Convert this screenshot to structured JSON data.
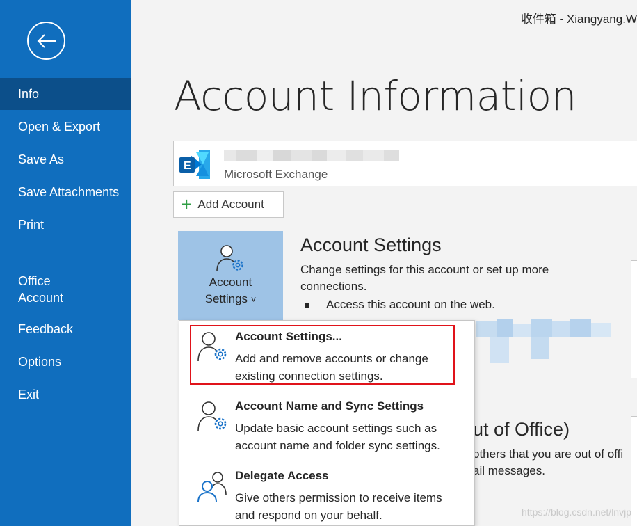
{
  "window": {
    "title": "收件箱 - Xiangyang.W"
  },
  "sidebar": {
    "items": [
      {
        "label": "Info",
        "active": true
      },
      {
        "label": "Open & Export"
      },
      {
        "label": "Save As"
      },
      {
        "label": "Save Attachments"
      },
      {
        "label": "Print"
      }
    ],
    "office_account": [
      "Office",
      "Account"
    ],
    "lower_items": [
      {
        "label": "Feedback"
      },
      {
        "label": "Options"
      },
      {
        "label": "Exit"
      }
    ]
  },
  "main": {
    "title": "Account Information",
    "account": {
      "type": "Microsoft Exchange",
      "logo_icon": "exchange-logo-icon"
    },
    "add_account_label": "Add Account",
    "account_settings_tile": {
      "line1": "Account",
      "line2": "Settings",
      "chevron": "˅"
    },
    "account_settings_section": {
      "title": "Account Settings",
      "description": "Change settings for this account or set up more connections.",
      "bullet": "Access this account on the web."
    },
    "out_of_office": {
      "title_partial": "ut of Office)",
      "desc_line1": "others that you are out of offi",
      "desc_line2": "ail messages."
    }
  },
  "dropdown": {
    "items": [
      {
        "title": "Account Settings...",
        "desc": "Add and remove accounts or change existing connection settings.",
        "icon": "account-settings-icon",
        "highlighted": true
      },
      {
        "title": "Account Name and Sync Settings",
        "desc": "Update basic account settings such as account name and folder sync settings.",
        "icon": "account-settings-icon"
      },
      {
        "title": "Delegate Access",
        "desc": "Give others permission to receive items and respond on your behalf.",
        "icon": "people-icon"
      }
    ]
  },
  "watermark": "https://blog.csdn.net/lnvjp",
  "colors": {
    "sidebar": "#106ebe",
    "sidebar_active": "#0c4f8a",
    "highlight": "#e0131a",
    "tile": "#9ec3e6"
  }
}
